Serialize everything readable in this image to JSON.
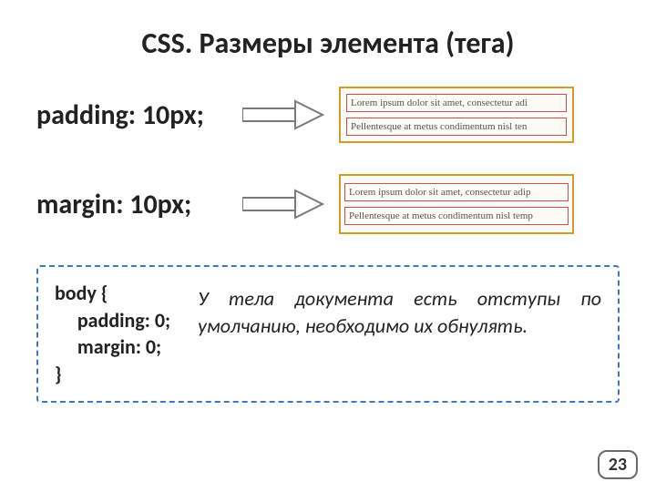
{
  "title": "CSS. Размеры элемента (тега)",
  "rows": [
    {
      "label": "padding: 10px;",
      "lorem1": "Lorem ipsum dolor sit amet, consectetur adi",
      "lorem2": "Pellentesque at metus condimentum nisl ten"
    },
    {
      "label": "margin: 10px;",
      "lorem1": "Lorem ipsum dolor sit amet, consectetur adip",
      "lorem2": "Pellentesque at metus condimentum nisl temp"
    }
  ],
  "code": "body {\n     padding: 0;\n     margin: 0;\n}",
  "note": "У тела документа есть отступы по умолчанию, необходимо их обнулять.",
  "page": "23",
  "arrow_color": "#7a7a7a"
}
